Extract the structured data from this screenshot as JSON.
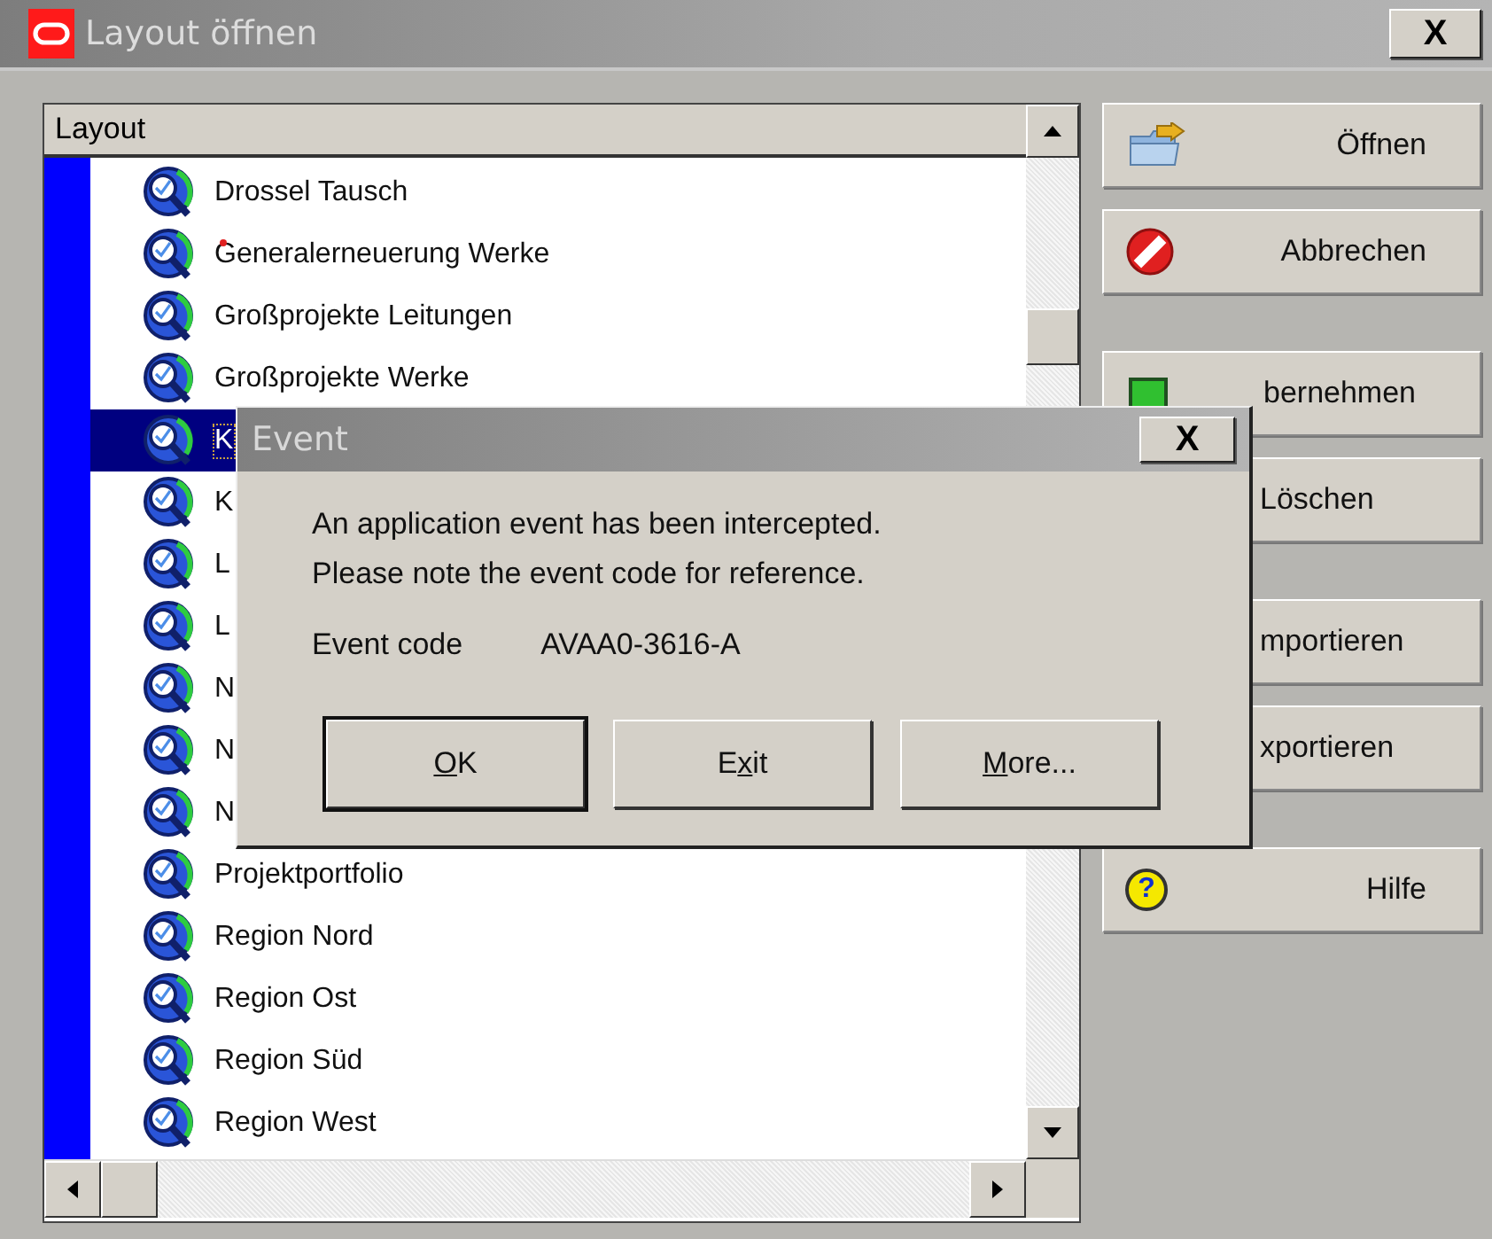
{
  "window": {
    "title": "Layout öffnen",
    "close": "X"
  },
  "list": {
    "header": "Layout",
    "rows": [
      {
        "label": "Drossel Tausch",
        "selected": false,
        "modified": false
      },
      {
        "label": "Generalerneuerung Werke",
        "selected": false,
        "modified": true
      },
      {
        "label": "Großprojekte Leitungen",
        "selected": false,
        "modified": false
      },
      {
        "label": "Großprojekte Werke",
        "selected": false,
        "modified": false
      },
      {
        "label": "K",
        "selected": true,
        "modified": false
      },
      {
        "label": "K",
        "selected": false,
        "modified": false
      },
      {
        "label": "L",
        "selected": false,
        "modified": false
      },
      {
        "label": "L",
        "selected": false,
        "modified": false
      },
      {
        "label": "N",
        "selected": false,
        "modified": false
      },
      {
        "label": "N",
        "selected": false,
        "modified": false
      },
      {
        "label": "N",
        "selected": false,
        "modified": false
      },
      {
        "label": "Projektportfolio",
        "selected": false,
        "modified": false
      },
      {
        "label": "Region Nord",
        "selected": false,
        "modified": false
      },
      {
        "label": "Region Ost",
        "selected": false,
        "modified": false
      },
      {
        "label": "Region Süd",
        "selected": false,
        "modified": false
      },
      {
        "label": "Region West",
        "selected": false,
        "modified": false
      }
    ]
  },
  "button_groups": [
    [
      {
        "label": "Öffnen",
        "kind": "open"
      },
      {
        "label": "Abbrechen",
        "kind": "cancel"
      }
    ],
    [
      {
        "label": "bernehmen",
        "kind": "apply"
      },
      {
        "label": "Löschen",
        "kind": "covered"
      }
    ],
    [
      {
        "label": "mportieren",
        "kind": "covered"
      },
      {
        "label": "xportieren",
        "kind": "covered"
      }
    ],
    [
      {
        "label": "Hilfe",
        "kind": "help",
        "icon_glyph": "?"
      }
    ]
  ],
  "dialog": {
    "title": "Event",
    "close": "X",
    "message": [
      "An application event has been intercepted.",
      "Please note the event code for reference."
    ],
    "code_label": "Event code",
    "code": "AVAA0-3616-A",
    "buttons": [
      {
        "key": "O",
        "after": "K",
        "default": true
      },
      {
        "before": "E",
        "key": "x",
        "after": "it",
        "default": false
      },
      {
        "key": "M",
        "after": "ore...",
        "default": false
      }
    ]
  }
}
